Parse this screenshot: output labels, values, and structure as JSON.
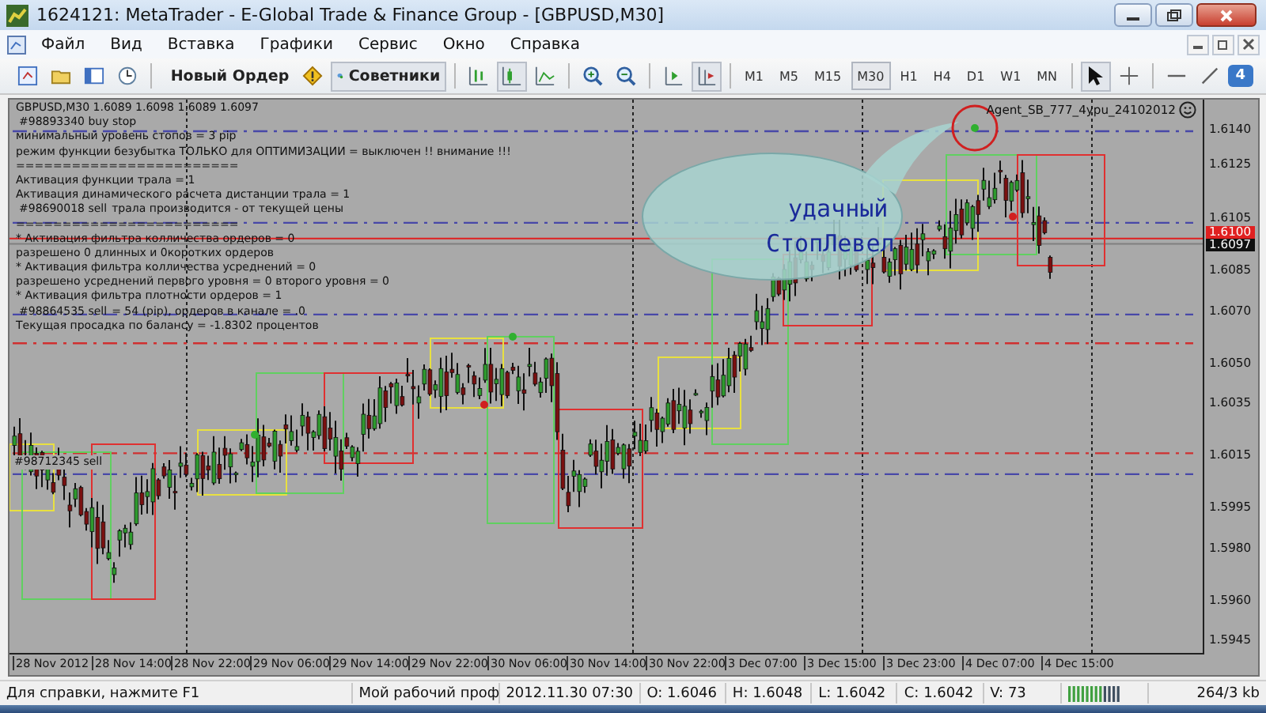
{
  "window": {
    "title": "1624121: MetaTrader - E-Global Trade & Finance Group - [GBPUSD,M30]"
  },
  "menu": [
    "Файл",
    "Вид",
    "Вставка",
    "Графики",
    "Сервис",
    "Окно",
    "Справка"
  ],
  "toolbar": {
    "new_order": "Новый Ордер",
    "experts": {
      "label": "Советники",
      "selected": true
    },
    "timeframes": [
      {
        "label": "M1",
        "selected": false
      },
      {
        "label": "M5",
        "selected": false
      },
      {
        "label": "M15",
        "selected": false
      },
      {
        "label": "M30",
        "selected": true
      },
      {
        "label": "H1",
        "selected": false
      },
      {
        "label": "H4",
        "selected": false
      },
      {
        "label": "D1",
        "selected": false
      },
      {
        "label": "W1",
        "selected": false
      },
      {
        "label": "MN",
        "selected": false
      }
    ],
    "notification_count": "4"
  },
  "chart": {
    "header": "GBPUSD,M30  1.6089 1.6098 1.6089 1.6097",
    "expert_name": "Agent_SB_777_4ypu_24102012",
    "info_lines": [
      "минимальный уровень стопов =  3  pip",
      "режим функции безубытка ТОЛЬКО для ОПТИМИЗАЦИИ =  выключен  !! внимание !!!",
      "========================",
      "Активация функции трала =  1",
      "Активация динамического расчета дистанции трала =  1",
      "трала производится - от текущей цены",
      "========================",
      "* Активация фильтра колличества ордеров =  0",
      "разрешено 0 длинных и 0коротких ордеров",
      "* Активация фильтра колличества усреднений =  0",
      "разрешено усреднений первого уровня =  0 второго уровня =  0",
      "* Активация фильтра плотности ордеров =  1",
      "= 54 (pip), ордеров в канале = .0",
      "Текущая просадка по балансу =  -1.8302 процентов"
    ],
    "order_labels": [
      "#98893340 buy stop",
      "#98690018 sell",
      "#98864535 sell",
      "#98712345 sell"
    ],
    "callout": [
      "удачный",
      "СтопЛевел"
    ],
    "price_labels": [
      "1.6140",
      "1.6125",
      "1.6105",
      "1.6085",
      "1.6070",
      "1.6050",
      "1.6035",
      "1.6015",
      "1.5995",
      "1.5980",
      "1.5960",
      "1.5945"
    ],
    "ask_badge": "1.6100",
    "bid_badge": "1.6097",
    "time_labels": [
      "28 Nov 2012",
      "28 Nov 14:00",
      "28 Nov 22:00",
      "29 Nov 06:00",
      "29 Nov 14:00",
      "29 Nov 22:00",
      "30 Nov 06:00",
      "30 Nov 14:00",
      "30 Nov 22:00",
      "3 Dec 07:00",
      "3 Dec 15:00",
      "3 Dec 23:00",
      "4 Dec 07:00",
      "4 Dec 15:00"
    ]
  },
  "status_bar": {
    "help": "Для справки, нажмите F1",
    "profile": "Мой рабочий проф",
    "time": "2012.11.30 07:30",
    "open": "O: 1.6046",
    "high": "H: 1.6048",
    "low": "L: 1.6042",
    "close": "C: 1.6042",
    "volume": "V: 73",
    "traffic": "264/3 kb"
  }
}
